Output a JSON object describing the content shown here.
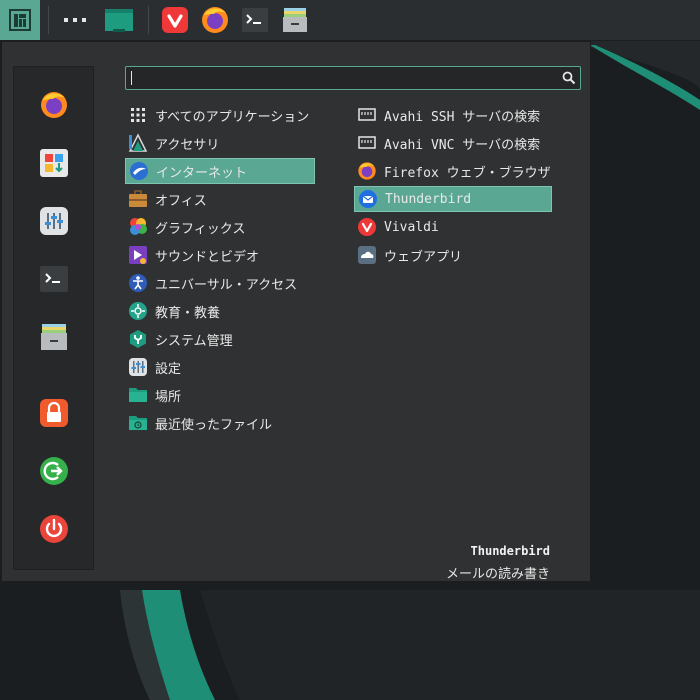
{
  "colors": {
    "accent": "#5aa893",
    "panel": "#2b2e30",
    "menu_bg": "#2f3132",
    "sidebar_bg": "#262829",
    "text": "#e8e8e8"
  },
  "taskbar": {
    "items": [
      "manjaro-menu-icon",
      "workspace-dots-icon",
      "show-desktop-icon",
      "vivaldi-icon",
      "firefox-icon",
      "terminal-icon",
      "file-manager-icon"
    ]
  },
  "sidebar": {
    "items": [
      "firefox-icon",
      "software-store-icon",
      "settings-icon",
      "terminal-icon",
      "file-manager-icon",
      "lock-icon",
      "logout-icon",
      "power-icon"
    ]
  },
  "search": {
    "value": "",
    "placeholder": ""
  },
  "categories": [
    {
      "label": "すべてのアプリケーション",
      "icon": "grid-icon"
    },
    {
      "label": "アクセサリ",
      "icon": "accessories-icon"
    },
    {
      "label": "インターネット",
      "icon": "internet-icon",
      "selected": true
    },
    {
      "label": "オフィス",
      "icon": "briefcase-icon"
    },
    {
      "label": "グラフィックス",
      "icon": "graphics-icon"
    },
    {
      "label": "サウンドとビデオ",
      "icon": "multimedia-icon"
    },
    {
      "label": "ユニバーサル・アクセス",
      "icon": "accessibility-icon"
    },
    {
      "label": "教育・教養",
      "icon": "education-icon"
    },
    {
      "label": "システム管理",
      "icon": "system-tools-icon"
    },
    {
      "label": "設定",
      "icon": "settings-icon"
    },
    {
      "label": "場所",
      "icon": "folder-icon"
    },
    {
      "label": "最近使ったファイル",
      "icon": "recent-folder-icon"
    }
  ],
  "apps": [
    {
      "label": "Avahi SSH サーバの検索",
      "icon": "network-icon"
    },
    {
      "label": "Avahi VNC サーバの検索",
      "icon": "network-icon"
    },
    {
      "label": "Firefox ウェブ・ブラウザ",
      "icon": "firefox-icon"
    },
    {
      "label": "Thunderbird",
      "icon": "thunderbird-icon",
      "selected": true
    },
    {
      "label": "Vivaldi",
      "icon": "vivaldi-icon"
    },
    {
      "label": "ウェブアプリ",
      "icon": "webapp-icon"
    }
  ],
  "info": {
    "title": "Thunderbird",
    "description": "メールの読み書き"
  }
}
